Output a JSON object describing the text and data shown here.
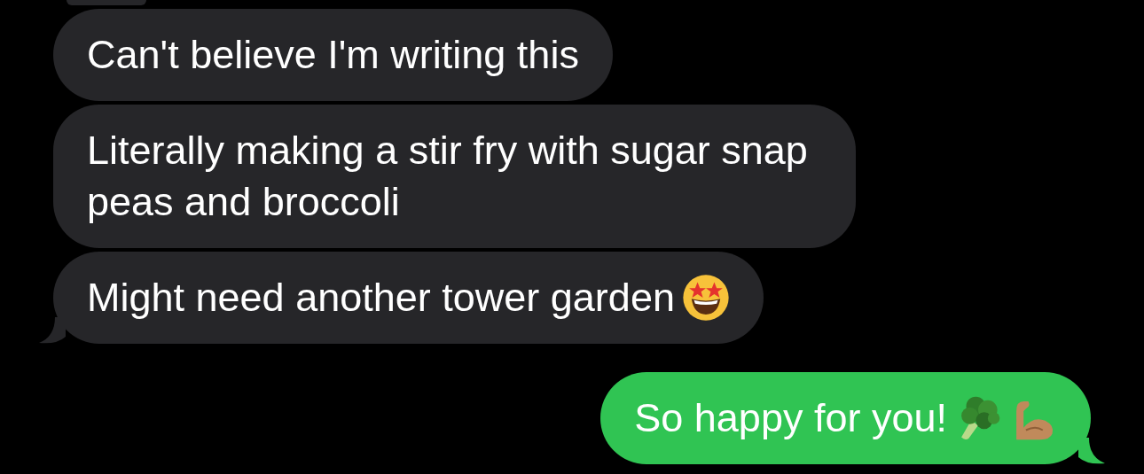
{
  "messages": [
    {
      "kind": "incoming",
      "text": "Can't believe I'm writing this",
      "tail": false
    },
    {
      "kind": "incoming",
      "text": "Literally making a stir fry with sugar snap peas and broccoli",
      "tail": false
    },
    {
      "kind": "incoming",
      "text": "Might need another tower garden",
      "tail": true,
      "emoji": [
        {
          "kind": "star-struck"
        }
      ]
    },
    {
      "kind": "outgoing",
      "text": "So happy for you!",
      "tail": true,
      "emoji": [
        {
          "kind": "broccoli"
        },
        {
          "kind": "flexed-biceps"
        }
      ]
    }
  ]
}
